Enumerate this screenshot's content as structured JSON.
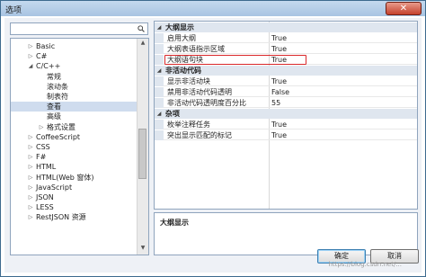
{
  "window": {
    "title": "选项",
    "close_glyph": "✕"
  },
  "search": {
    "placeholder": ""
  },
  "tree": [
    {
      "label": "Basic",
      "arrow": "▷",
      "level": 0
    },
    {
      "label": "C#",
      "arrow": "▷",
      "level": 0
    },
    {
      "label": "C/C++",
      "arrow": "◢",
      "level": 0
    },
    {
      "label": "常规",
      "arrow": "",
      "level": 1
    },
    {
      "label": "滚动条",
      "arrow": "",
      "level": 1
    },
    {
      "label": "制表符",
      "arrow": "",
      "level": 1
    },
    {
      "label": "查看",
      "arrow": "",
      "level": 1,
      "selected": true
    },
    {
      "label": "高级",
      "arrow": "",
      "level": 1
    },
    {
      "label": "格式设置",
      "arrow": "▷",
      "level": 1
    },
    {
      "label": "CoffeeScript",
      "arrow": "▷",
      "level": 0
    },
    {
      "label": "CSS",
      "arrow": "▷",
      "level": 0
    },
    {
      "label": "F#",
      "arrow": "▷",
      "level": 0
    },
    {
      "label": "HTML",
      "arrow": "▷",
      "level": 0
    },
    {
      "label": "HTML(Web 窗体)",
      "arrow": "▷",
      "level": 0
    },
    {
      "label": "JavaScript",
      "arrow": "▷",
      "level": 0
    },
    {
      "label": "JSON",
      "arrow": "▷",
      "level": 0
    },
    {
      "label": "LESS",
      "arrow": "▷",
      "level": 0
    },
    {
      "label": "RestJSON 资源",
      "arrow": "▷",
      "level": 0
    }
  ],
  "grid": [
    {
      "type": "cat",
      "name": "大纲显示"
    },
    {
      "type": "prop",
      "name": "启用大纲",
      "value": "True"
    },
    {
      "type": "prop",
      "name": "大纲表语指示区域",
      "value": "True"
    },
    {
      "type": "prop",
      "name": "大纲语句块",
      "value": "True",
      "highlight": true
    },
    {
      "type": "cat",
      "name": "非活动代码"
    },
    {
      "type": "prop",
      "name": "显示非活动块",
      "value": "True"
    },
    {
      "type": "prop",
      "name": "禁用非活动代码透明",
      "value": "False"
    },
    {
      "type": "prop",
      "name": "非活动代码透明度百分比",
      "value": "55"
    },
    {
      "type": "cat",
      "name": "杂项"
    },
    {
      "type": "prop",
      "name": "枚举注释任务",
      "value": "True"
    },
    {
      "type": "prop",
      "name": "突出显示匹配的标记",
      "value": "True"
    }
  ],
  "description": {
    "title": "大纲显示"
  },
  "buttons": {
    "ok": "确定",
    "cancel": "取消"
  },
  "watermark": "https://blog.csdn.net/..."
}
